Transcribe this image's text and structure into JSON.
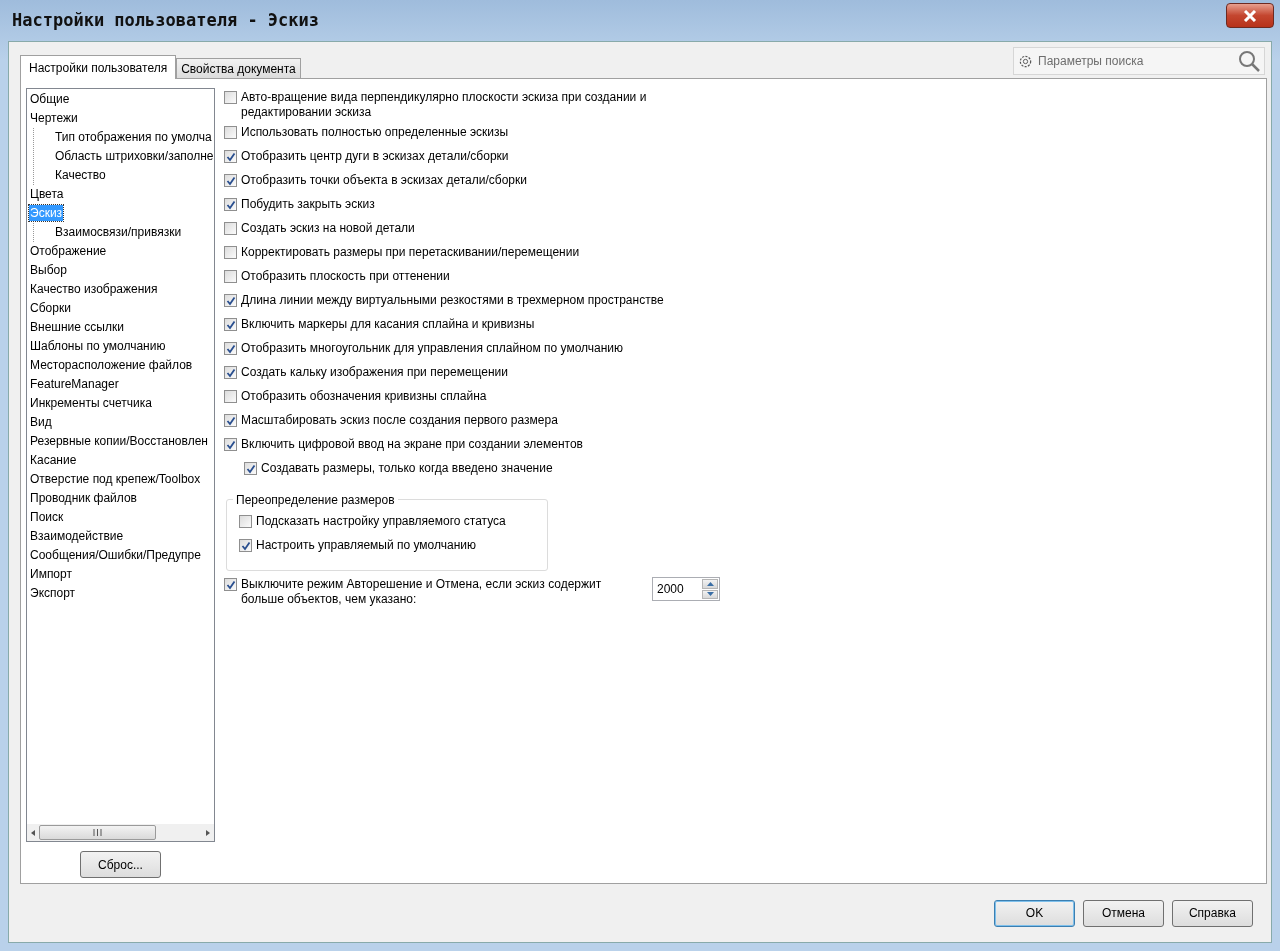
{
  "window": {
    "title": "Настройки пользователя - Эскиз"
  },
  "tabs": [
    {
      "label": "Настройки пользователя",
      "selected": true
    },
    {
      "label": "Свойства документа",
      "selected": false
    }
  ],
  "search": {
    "placeholder": "Параметры поиска"
  },
  "tree": [
    {
      "label": "Общие",
      "selected": false
    },
    {
      "label": "Чертежи",
      "selected": false,
      "children": [
        {
          "label": "Тип отображения по умолча",
          "selected": false
        },
        {
          "label": "Область штриховки/заполне",
          "selected": false
        },
        {
          "label": "Качество",
          "selected": false
        }
      ]
    },
    {
      "label": "Цвета",
      "selected": false
    },
    {
      "label": "Эскиз",
      "selected": true,
      "children": [
        {
          "label": "Взаимосвязи/привязки",
          "selected": false
        }
      ]
    },
    {
      "label": "Отображение",
      "selected": false
    },
    {
      "label": "Выбор",
      "selected": false
    },
    {
      "label": "Качество изображения",
      "selected": false
    },
    {
      "label": "Сборки",
      "selected": false
    },
    {
      "label": "Внешние ссылки",
      "selected": false
    },
    {
      "label": "Шаблоны по умолчанию",
      "selected": false
    },
    {
      "label": "Месторасположение файлов",
      "selected": false
    },
    {
      "label": "FeatureManager",
      "selected": false
    },
    {
      "label": "Инкременты счетчика",
      "selected": false
    },
    {
      "label": "Вид",
      "selected": false
    },
    {
      "label": "Резервные копии/Восстановлен",
      "selected": false
    },
    {
      "label": "Касание",
      "selected": false
    },
    {
      "label": "Отверстие под крепеж/Toolbox",
      "selected": false
    },
    {
      "label": "Проводник файлов",
      "selected": false
    },
    {
      "label": "Поиск",
      "selected": false
    },
    {
      "label": "Взаимодействие",
      "selected": false
    },
    {
      "label": "Сообщения/Ошибки/Предупре",
      "selected": false
    },
    {
      "label": "Импорт",
      "selected": false
    },
    {
      "label": "Экспорт",
      "selected": false
    }
  ],
  "reset_button": "Сброс...",
  "options": [
    {
      "label": "Авто-вращение вида перпендикулярно плоскости эскиза при создании и редактировании эскиза",
      "checked": false
    },
    {
      "label": "Использовать полностью определенные эскизы",
      "checked": false
    },
    {
      "label": "Отобразить центр дуги в эскизах детали/сборки",
      "checked": true
    },
    {
      "label": "Отобразить точки объекта в эскизах детали/сборки",
      "checked": true
    },
    {
      "label": "Побудить закрыть эскиз",
      "checked": true
    },
    {
      "label": "Создать эскиз на новой детали",
      "checked": false
    },
    {
      "label": "Корректировать размеры при перетаскивании/перемещении",
      "checked": false
    },
    {
      "label": "Отобразить плоскость при оттенении",
      "checked": false
    },
    {
      "label": "Длина линии между виртуальными резкостями в трехмерном пространстве",
      "checked": true
    },
    {
      "label": "Включить маркеры для касания сплайна и кривизны",
      "checked": true
    },
    {
      "label": "Отобразить многоугольник для управления сплайном по умолчанию",
      "checked": true
    },
    {
      "label": "Создать кальку изображения при перемещении",
      "checked": true
    },
    {
      "label": "Отобразить обозначения кривизны сплайна",
      "checked": false
    },
    {
      "label": "Масштабировать эскиз после создания первого размера",
      "checked": true
    },
    {
      "label": "Включить цифровой ввод на экране при создании элементов",
      "checked": true,
      "children": [
        {
          "label": "Создавать размеры, только когда введено значение",
          "checked": true
        }
      ]
    }
  ],
  "dimension_group": {
    "title": "Переопределение размеров",
    "options": [
      {
        "label": "Подсказать настройку управляемого статуса",
        "checked": false
      },
      {
        "label": "Настроить управляемый по умолчанию",
        "checked": true
      }
    ]
  },
  "limit_option": {
    "label": "Выключите режим Авторешение и Отмена, если эскиз содержит больше объектов, чем указано:",
    "checked": true,
    "value": "2000"
  },
  "buttons": [
    "OK",
    "Отмена",
    "Справка"
  ]
}
